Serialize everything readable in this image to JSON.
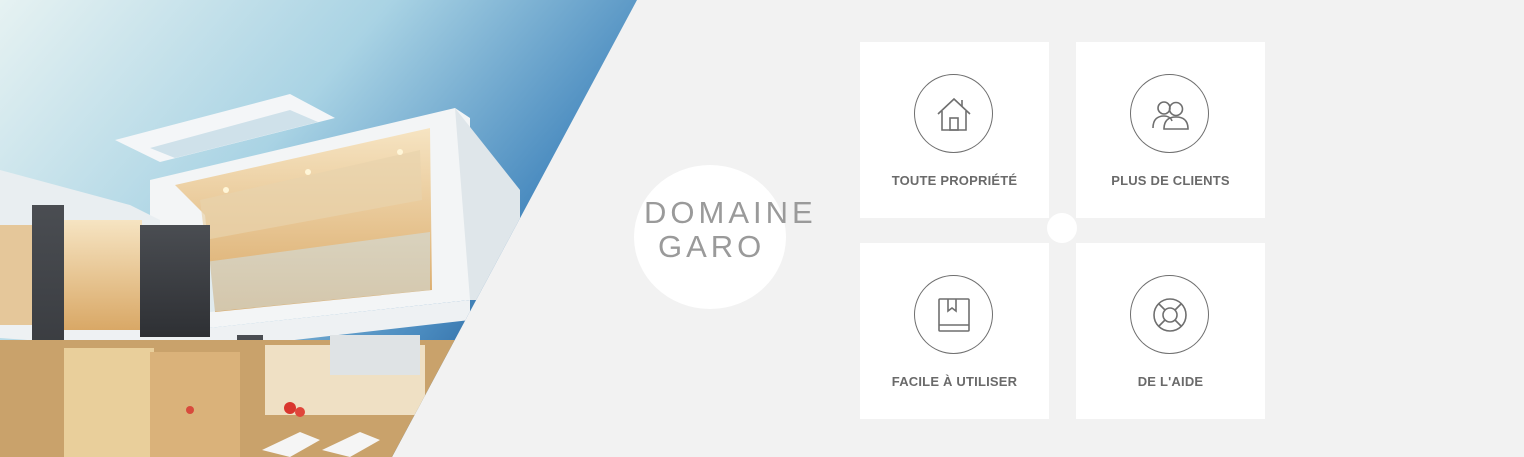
{
  "brand": {
    "line1": "DOMAINE",
    "line2": "GARO"
  },
  "features": [
    {
      "label": "TOUTE PROPRIÉTÉ",
      "icon": "house-icon"
    },
    {
      "label": "PLUS DE CLIENTS",
      "icon": "users-icon"
    },
    {
      "label": "FACILE À UTILISER",
      "icon": "book-icon"
    },
    {
      "label": "DE L'AIDE",
      "icon": "lifebuoy-icon"
    }
  ],
  "colors": {
    "background": "#f2f2f2",
    "card": "#ffffff",
    "text": "#6a6a6a",
    "brand_text": "#9a9a9a",
    "sky_top": "#1d5c98",
    "sky_light": "#cfe6ee"
  }
}
